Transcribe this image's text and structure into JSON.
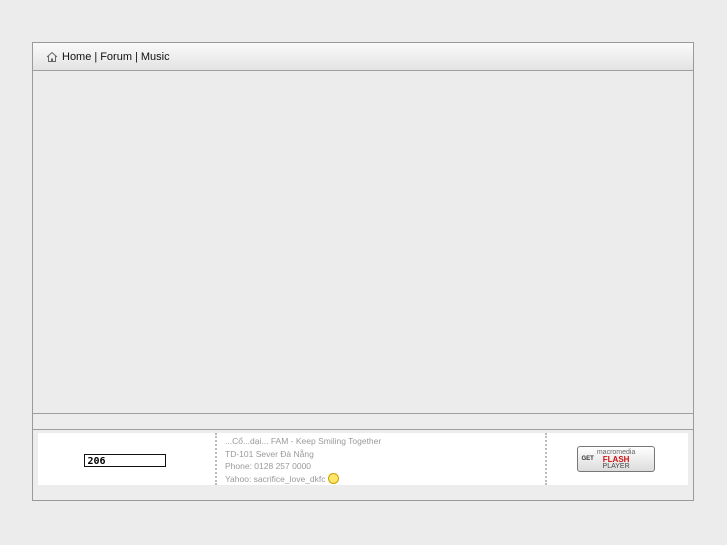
{
  "nav": {
    "home_icon": "home-icon",
    "items": [
      "Home",
      "Forum",
      "Music"
    ],
    "separator": "|"
  },
  "footer": {
    "counter": "206",
    "info": {
      "line1": "...Cổ...dại... FAM - Keep Smiling Together",
      "line2": "TD-101 Sever Đà Nẵng",
      "line3": "Phone: 0128 257 0000",
      "line4": "Yahoo: sacrifice_love_dkfc"
    },
    "flash_badge": {
      "get": "GET",
      "brand": "macromedia",
      "flash": "FLASH",
      "player": "PLAYER"
    }
  }
}
